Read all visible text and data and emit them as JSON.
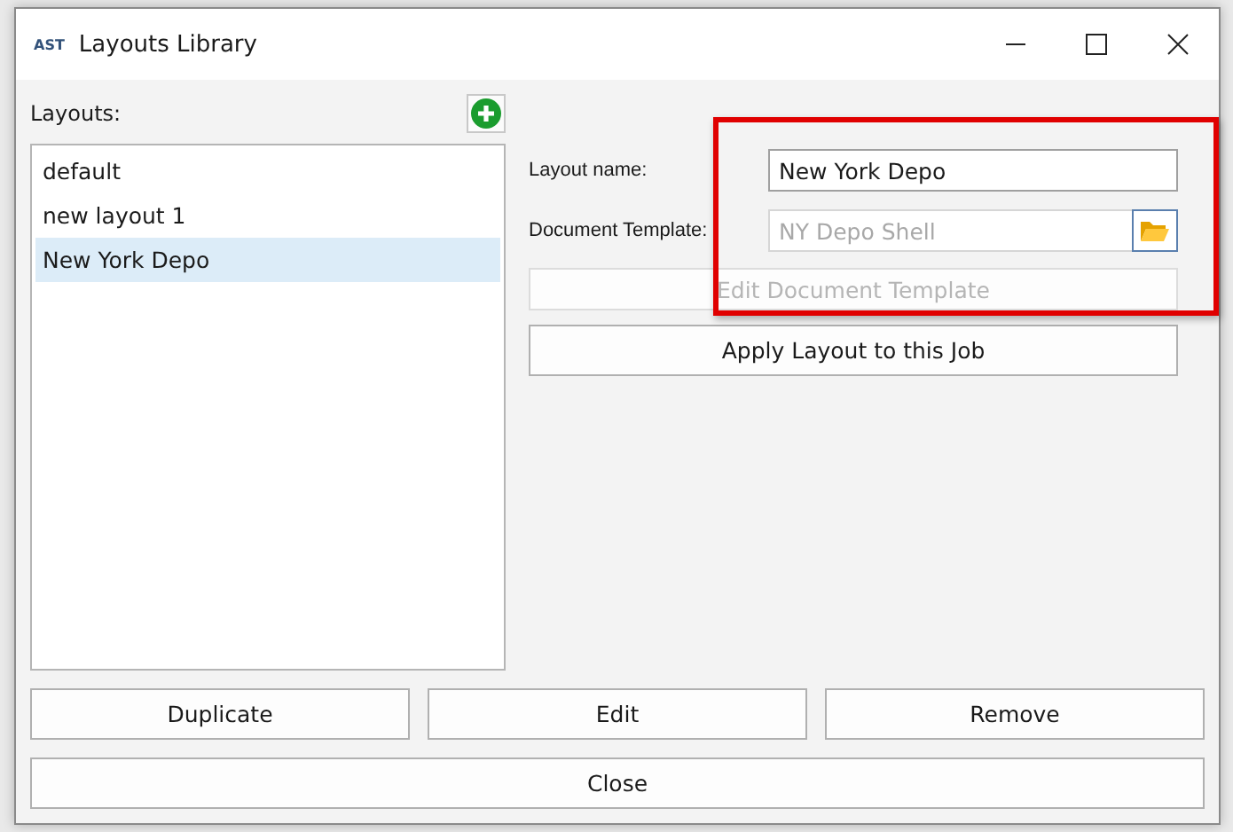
{
  "window": {
    "logo": "AST",
    "title": "Layouts Library"
  },
  "layouts_label": "Layouts:",
  "layouts": [
    {
      "name": "default",
      "selected": false
    },
    {
      "name": "new layout 1",
      "selected": false
    },
    {
      "name": "New York Depo",
      "selected": true
    }
  ],
  "form": {
    "layout_name_label": "Layout name:",
    "layout_name": "New York Depo",
    "template_label": "Document Template:",
    "template_value": "NY Depo Shell",
    "template_disabled": true
  },
  "edit_template_button": {
    "label": "Edit Document Template",
    "disabled": true
  },
  "apply_button": {
    "label": "Apply Layout to this Job",
    "disabled": false
  },
  "buttons": [
    "Duplicate",
    "Edit",
    "Remove"
  ],
  "close_button": "Close",
  "highlight_box": true
}
